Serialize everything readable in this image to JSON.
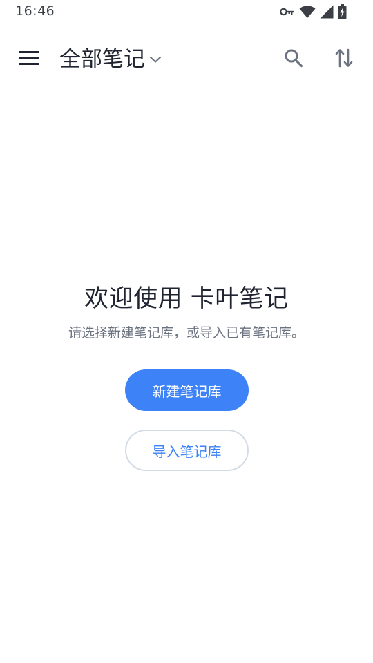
{
  "status_bar": {
    "time": "16:46",
    "icons": [
      "vpn-key-icon",
      "wifi-icon",
      "signal-icon",
      "battery-charging-icon"
    ]
  },
  "app_bar": {
    "title": "全部笔记",
    "icons": {
      "menu": "menu-icon",
      "dropdown": "chevron-down-icon",
      "search": "search-icon",
      "sort": "sort-icon"
    }
  },
  "empty_state": {
    "title": "欢迎使用 卡叶笔记",
    "subtitle": "请选择新建笔记库，或导入已有笔记库。",
    "primary_button": "新建笔记库",
    "secondary_button": "导入笔记库"
  },
  "colors": {
    "accent": "#3d82f6",
    "text_primary": "#1f2430",
    "text_secondary": "#6b7280",
    "outline": "#d3dbe6",
    "background": "#ffffff"
  }
}
